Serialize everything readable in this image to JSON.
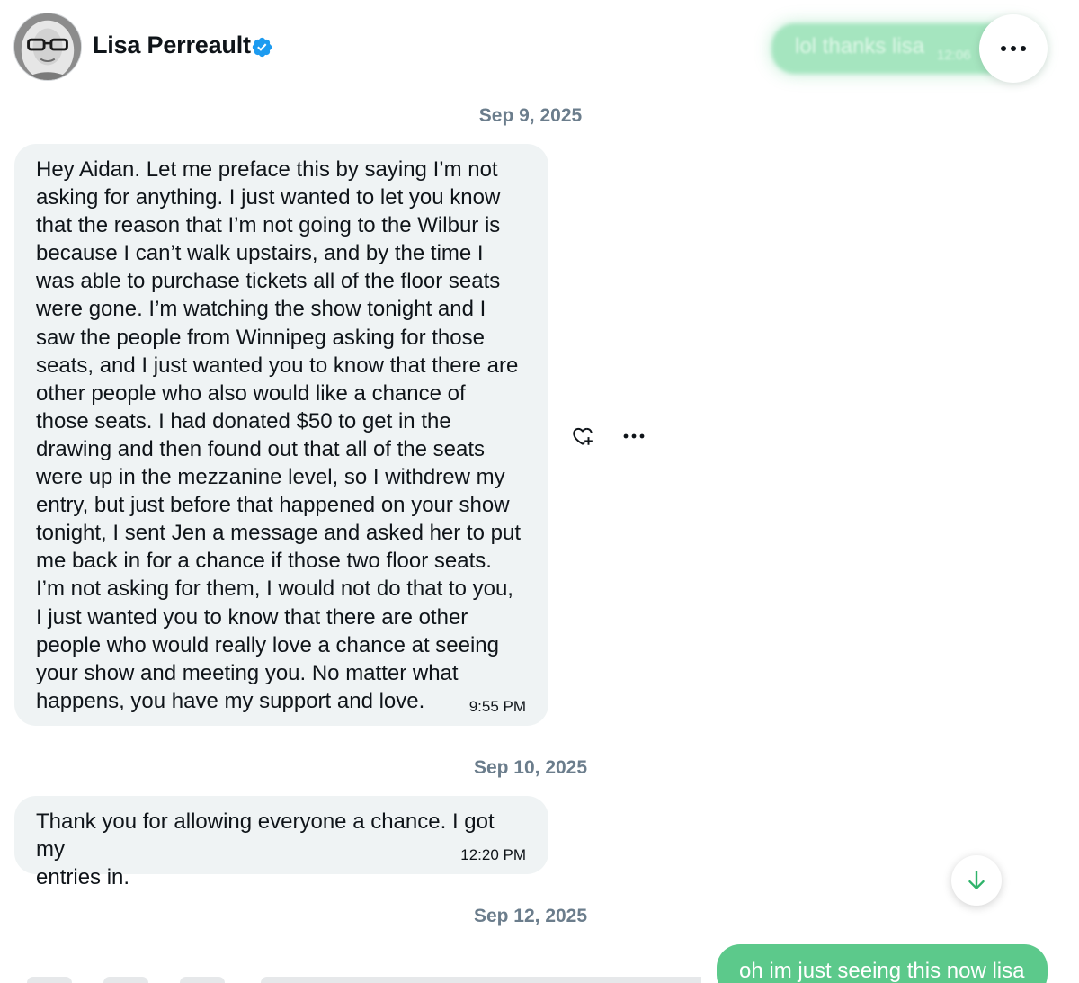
{
  "header": {
    "contact_name": "Lisa Perreault",
    "verified_color": "#1d9bf0",
    "faded_message": "lol thanks lisa",
    "faded_time": "12:06"
  },
  "conversation": {
    "groups": [
      {
        "date": "Sep 9, 2025",
        "messages": [
          {
            "text": "Hey Aidan.  Let me preface this by saying I’m not\nasking for anything.  I just wanted to let you know\nthat the reason that I’m not going to the Wilbur is\nbecause I can’t walk upstairs, and by the time I\nwas able to purchase tickets all of the floor seats\nwere gone. I’m watching the show tonight and I\nsaw the people from Winnipeg asking for those\nseats, and I just wanted you to know that there are\nother people who also would like a chance of\nthose seats. I had donated $50 to get in the\ndrawing and then found out that all of the seats\nwere up in the mezzanine level, so I withdrew my\nentry, but just before that happened on your show\ntonight, I sent Jen a message and asked her to put\nme back in for a chance if those two floor seats.\nI’m not asking for them, I would not do that to you,\nI just wanted you to know that there are other\npeople who would really love a chance at seeing\nyour show and meeting you. No matter what\nhappens, you have my support and love.",
            "time": "9:55 PM"
          }
        ]
      },
      {
        "date": "Sep 10, 2025",
        "messages": [
          {
            "text": "Thank you for allowing everyone a chance. I got my\nentries in.",
            "time": "12:20 PM"
          }
        ]
      },
      {
        "date": "Sep 12, 2025",
        "messages": [
          {
            "text": "oh im just seeing this now lisa",
            "sent": true
          }
        ]
      }
    ]
  },
  "colors": {
    "received_bubble": "#eff3f4",
    "sent_bubble": "#5cc98b",
    "accent_green": "#2fb36a",
    "date_text": "#6b7d8c"
  },
  "icons": {
    "more": "more-horizontal-icon",
    "react": "heart-plus-icon",
    "scroll": "arrow-down-icon",
    "verified": "verified-badge-icon"
  }
}
